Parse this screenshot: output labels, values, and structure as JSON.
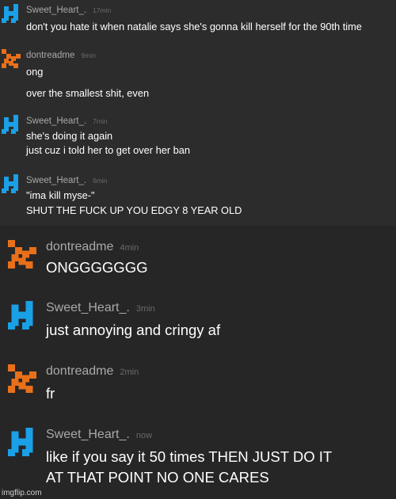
{
  "messages": [
    {
      "user": "Sweet_Heart_.",
      "avatar_icon": "blue-pixel-avatar-icon",
      "time": "17min",
      "lines": [
        "don't you hate it when natalie says she's gonna kill herself for the 90th time"
      ]
    },
    {
      "user": "dontreadme",
      "avatar_icon": "orange-pixel-avatar-icon",
      "time": "9min",
      "lines": [
        "ong",
        "over the smallest shit, even"
      ]
    },
    {
      "user": "Sweet_Heart_.",
      "avatar_icon": "blue-pixel-avatar-icon",
      "time": "7min",
      "lines": [
        "she's doing it again",
        "just cuz i told her to get over her ban"
      ]
    },
    {
      "user": "Sweet_Heart_.",
      "avatar_icon": "blue-pixel-avatar-icon",
      "time": "6min",
      "lines": [
        "\"ima kill myse-\"",
        "SHUT THE FUCK UP YOU EDGY 8 YEAR OLD"
      ]
    },
    {
      "user": "dontreadme",
      "avatar_icon": "orange-pixel-avatar-icon",
      "time": "4min",
      "lines": [
        "ONGGGGGGG"
      ]
    },
    {
      "user": "Sweet_Heart_.",
      "avatar_icon": "blue-pixel-avatar-icon",
      "time": "3min",
      "lines": [
        "just annoying and cringy af"
      ]
    },
    {
      "user": "dontreadme",
      "avatar_icon": "orange-pixel-avatar-icon",
      "time": "2min",
      "lines": [
        "fr"
      ]
    },
    {
      "user": "Sweet_Heart_.",
      "avatar_icon": "blue-pixel-avatar-icon",
      "time": "now",
      "lines": [
        "like if you say it 50 times THEN JUST DO IT",
        "AT THAT POINT NO ONE CARES"
      ]
    }
  ],
  "watermark": "imgflip.com",
  "colors": {
    "blue_avatar": "#1aa0e6",
    "orange_avatar": "#e8701a",
    "username": "#a9a9a9",
    "timestamp": "#6a6a6a",
    "message_text": "#ffffff"
  }
}
